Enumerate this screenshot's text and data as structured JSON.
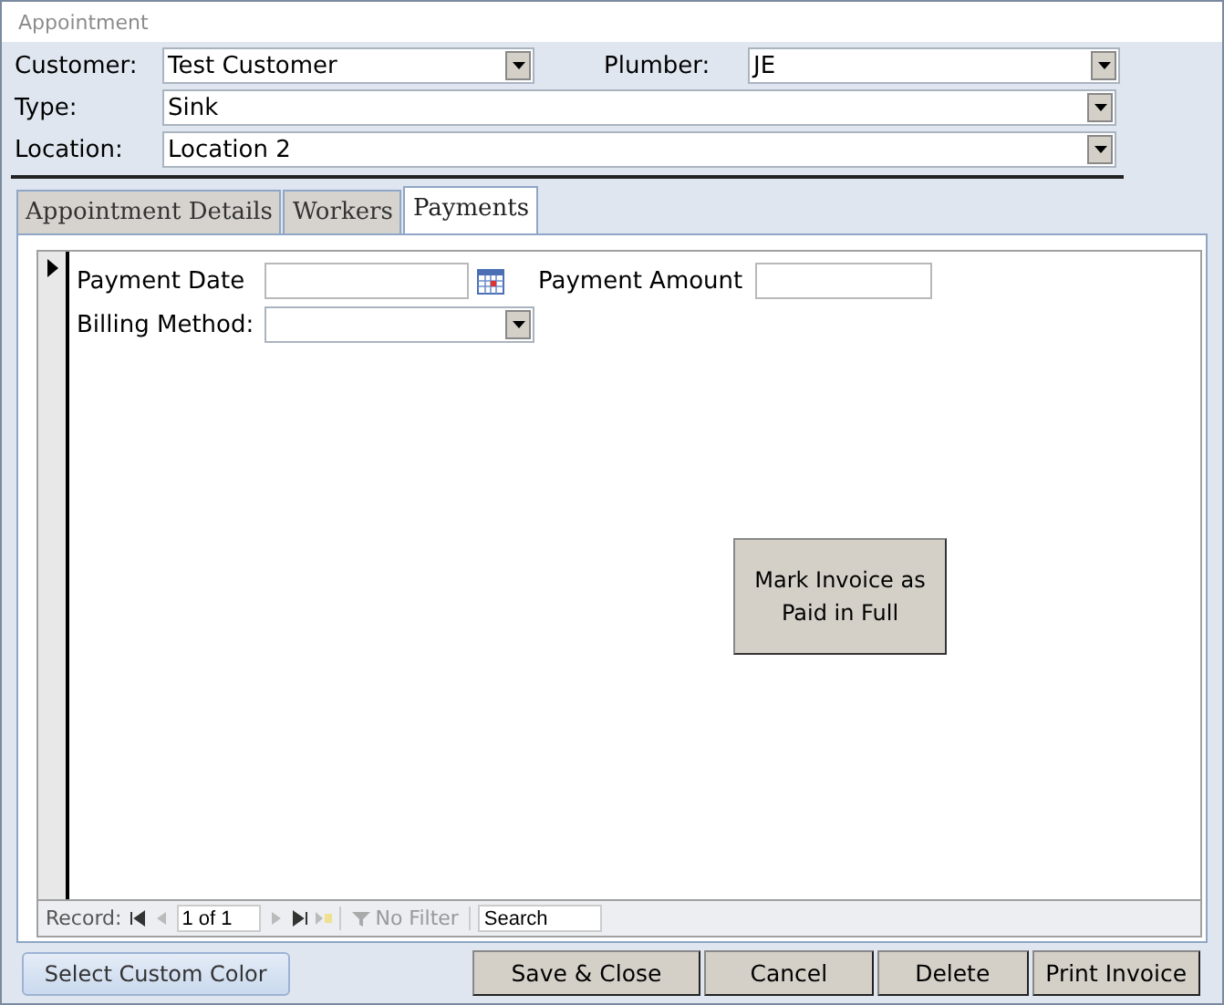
{
  "window": {
    "title": "Appointment"
  },
  "header": {
    "rows": [
      [
        {
          "label": "Customer:",
          "value": "Test Customer",
          "kind": "combo"
        },
        {
          "label": "Plumber:",
          "value": "JE",
          "kind": "combo"
        }
      ],
      [
        {
          "label": "Type:",
          "value": "Sink",
          "kind": "combo"
        }
      ],
      [
        {
          "label": "Location:",
          "value": "Location 2",
          "kind": "combo"
        }
      ]
    ]
  },
  "tabs": [
    {
      "label": "Appointment Details",
      "selected": false
    },
    {
      "label": "Workers",
      "selected": false
    },
    {
      "label": "Payments",
      "selected": true
    }
  ],
  "payment_form": {
    "current_record": true,
    "fields": [
      {
        "label": "Payment Date",
        "kind": "date"
      },
      {
        "label": "Payment Amount",
        "kind": "text"
      },
      {
        "label": "Billing Method:",
        "kind": "combo"
      }
    ],
    "action_button": {
      "label": "Mark Invoice as Paid in Full"
    }
  },
  "navigation": {
    "label": "Record:",
    "position": "1 of 1",
    "filter": "No Filter",
    "search": {
      "placeholder": "Search"
    }
  },
  "footer": {
    "color_button": "Select Custom Color",
    "buttons": [
      "Save & Close",
      "Cancel",
      "Delete",
      "Print Invoice"
    ]
  }
}
